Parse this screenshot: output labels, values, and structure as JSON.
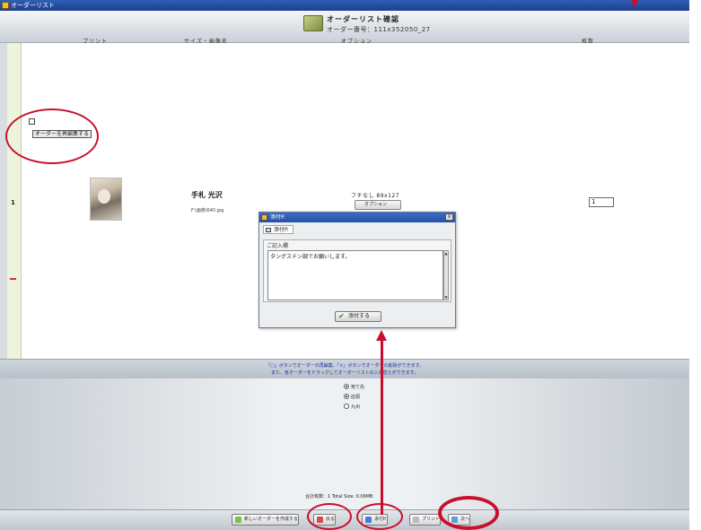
{
  "window": {
    "title": "オーダーリスト"
  },
  "header": {
    "title": "オーダーリスト確認",
    "order_number": "オーダー番号：111x352050_27",
    "columns": {
      "print": "プリント",
      "size": "サイズ・画像名",
      "option": "オプション",
      "qty": "枚数"
    }
  },
  "row": {
    "index": "1",
    "reedit_label": "オーダーを再編集する",
    "person": "手札 光沢",
    "filename": "F:\\画像\\640.jpg",
    "option_title": "フチなし 89x127",
    "option_button": "オプション",
    "quantity": "1"
  },
  "dialog": {
    "title": "添付P.",
    "tab_label": "添付P.",
    "group_label": "ご記入欄",
    "text": "タングステン調でお願いします。",
    "attach_button": "添付する",
    "close": "x"
  },
  "instructions": {
    "line1": "「□」ボタンでオーダーの再編集、「×」ボタンでオーダーの削除ができます。",
    "line2": "また、各オーダーをドラッグしてオーダーリストの入れ替えができます。"
  },
  "destination": {
    "options": [
      {
        "label": "宛て先",
        "selected": true
      },
      {
        "label": "店頭",
        "selected": true
      },
      {
        "label": "九州",
        "selected": false
      }
    ]
  },
  "totals": {
    "text": "合計枚数：1    Total Size: 0.09MB"
  },
  "buttons": {
    "new_order": "新しいオーダーを作成する",
    "back": "戻る",
    "attach": "添付P.",
    "print": "プリント",
    "next": "次へ"
  },
  "colors": {
    "accent_red": "#c8102e",
    "title_blue": "#2550a8"
  }
}
